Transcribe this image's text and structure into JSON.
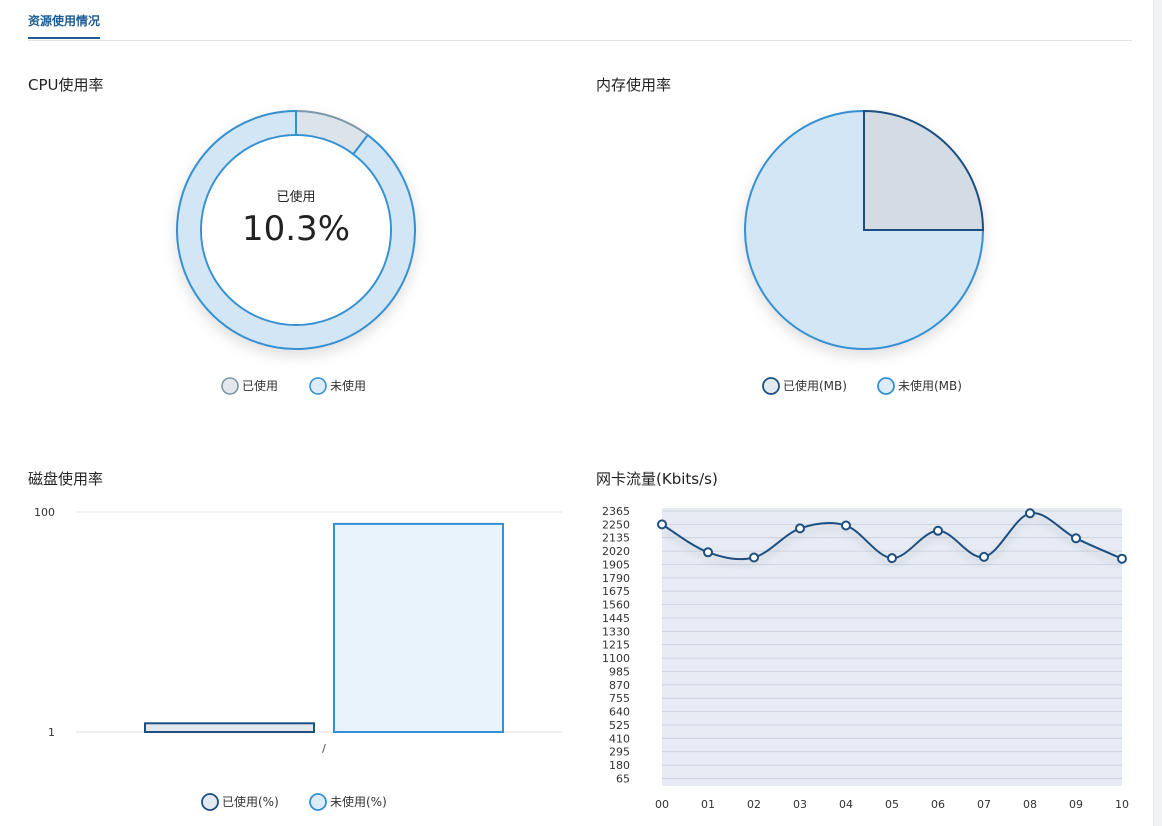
{
  "tabs": [
    {
      "label": "资源使用情况",
      "active": true
    }
  ],
  "colors": {
    "accent": "#1f5c94",
    "used_stroke": "#1d4f80",
    "used_fill": "#d3dbe5",
    "unused_stroke": "#3590d2",
    "unused_fill": "#d2e6f5",
    "area_fill": "#e6ebf4"
  },
  "chart_data": [
    {
      "type": "pie",
      "variant": "donut",
      "title": "CPU使用率",
      "center_label": "已使用",
      "center_value": "10.3%",
      "slices": [
        {
          "name": "已使用",
          "value": 10.3
        },
        {
          "name": "未使用",
          "value": 89.7
        }
      ],
      "legend": [
        "已使用",
        "未使用"
      ],
      "legend_position": "bottom"
    },
    {
      "type": "pie",
      "title": "内存使用率",
      "slices": [
        {
          "name": "已使用(MB)",
          "value": 25
        },
        {
          "name": "未使用(MB)",
          "value": 75
        }
      ],
      "legend": [
        "已使用(MB)",
        "未使用(MB)"
      ],
      "legend_position": "bottom"
    },
    {
      "type": "bar",
      "title": "磁盘使用率",
      "scale": "log",
      "categories": [
        "/"
      ],
      "yticks": [
        "1",
        "100"
      ],
      "ylim": [
        1,
        100
      ],
      "series": [
        {
          "name": "已使用(%)",
          "values": [
            1.2
          ]
        },
        {
          "name": "未使用(%)",
          "values": [
            78
          ]
        }
      ],
      "legend": [
        "已使用(%)",
        "未使用(%)"
      ],
      "legend_position": "bottom"
    },
    {
      "type": "area",
      "title": "网卡流量(Kbits/s)",
      "x": [
        "00",
        "01",
        "02",
        "03",
        "04",
        "05",
        "06",
        "07",
        "08",
        "09",
        "10"
      ],
      "values": [
        2250,
        2010,
        1965,
        2215,
        2240,
        1960,
        2195,
        1970,
        2345,
        2130,
        1955
      ],
      "yticks": [
        "65",
        "180",
        "295",
        "410",
        "525",
        "640",
        "755",
        "870",
        "985",
        "1100",
        "1215",
        "1330",
        "1445",
        "1560",
        "1675",
        "1790",
        "1905",
        "2020",
        "2135",
        "2250",
        "2365"
      ],
      "ylim": [
        0,
        2365
      ],
      "grid": true
    }
  ]
}
